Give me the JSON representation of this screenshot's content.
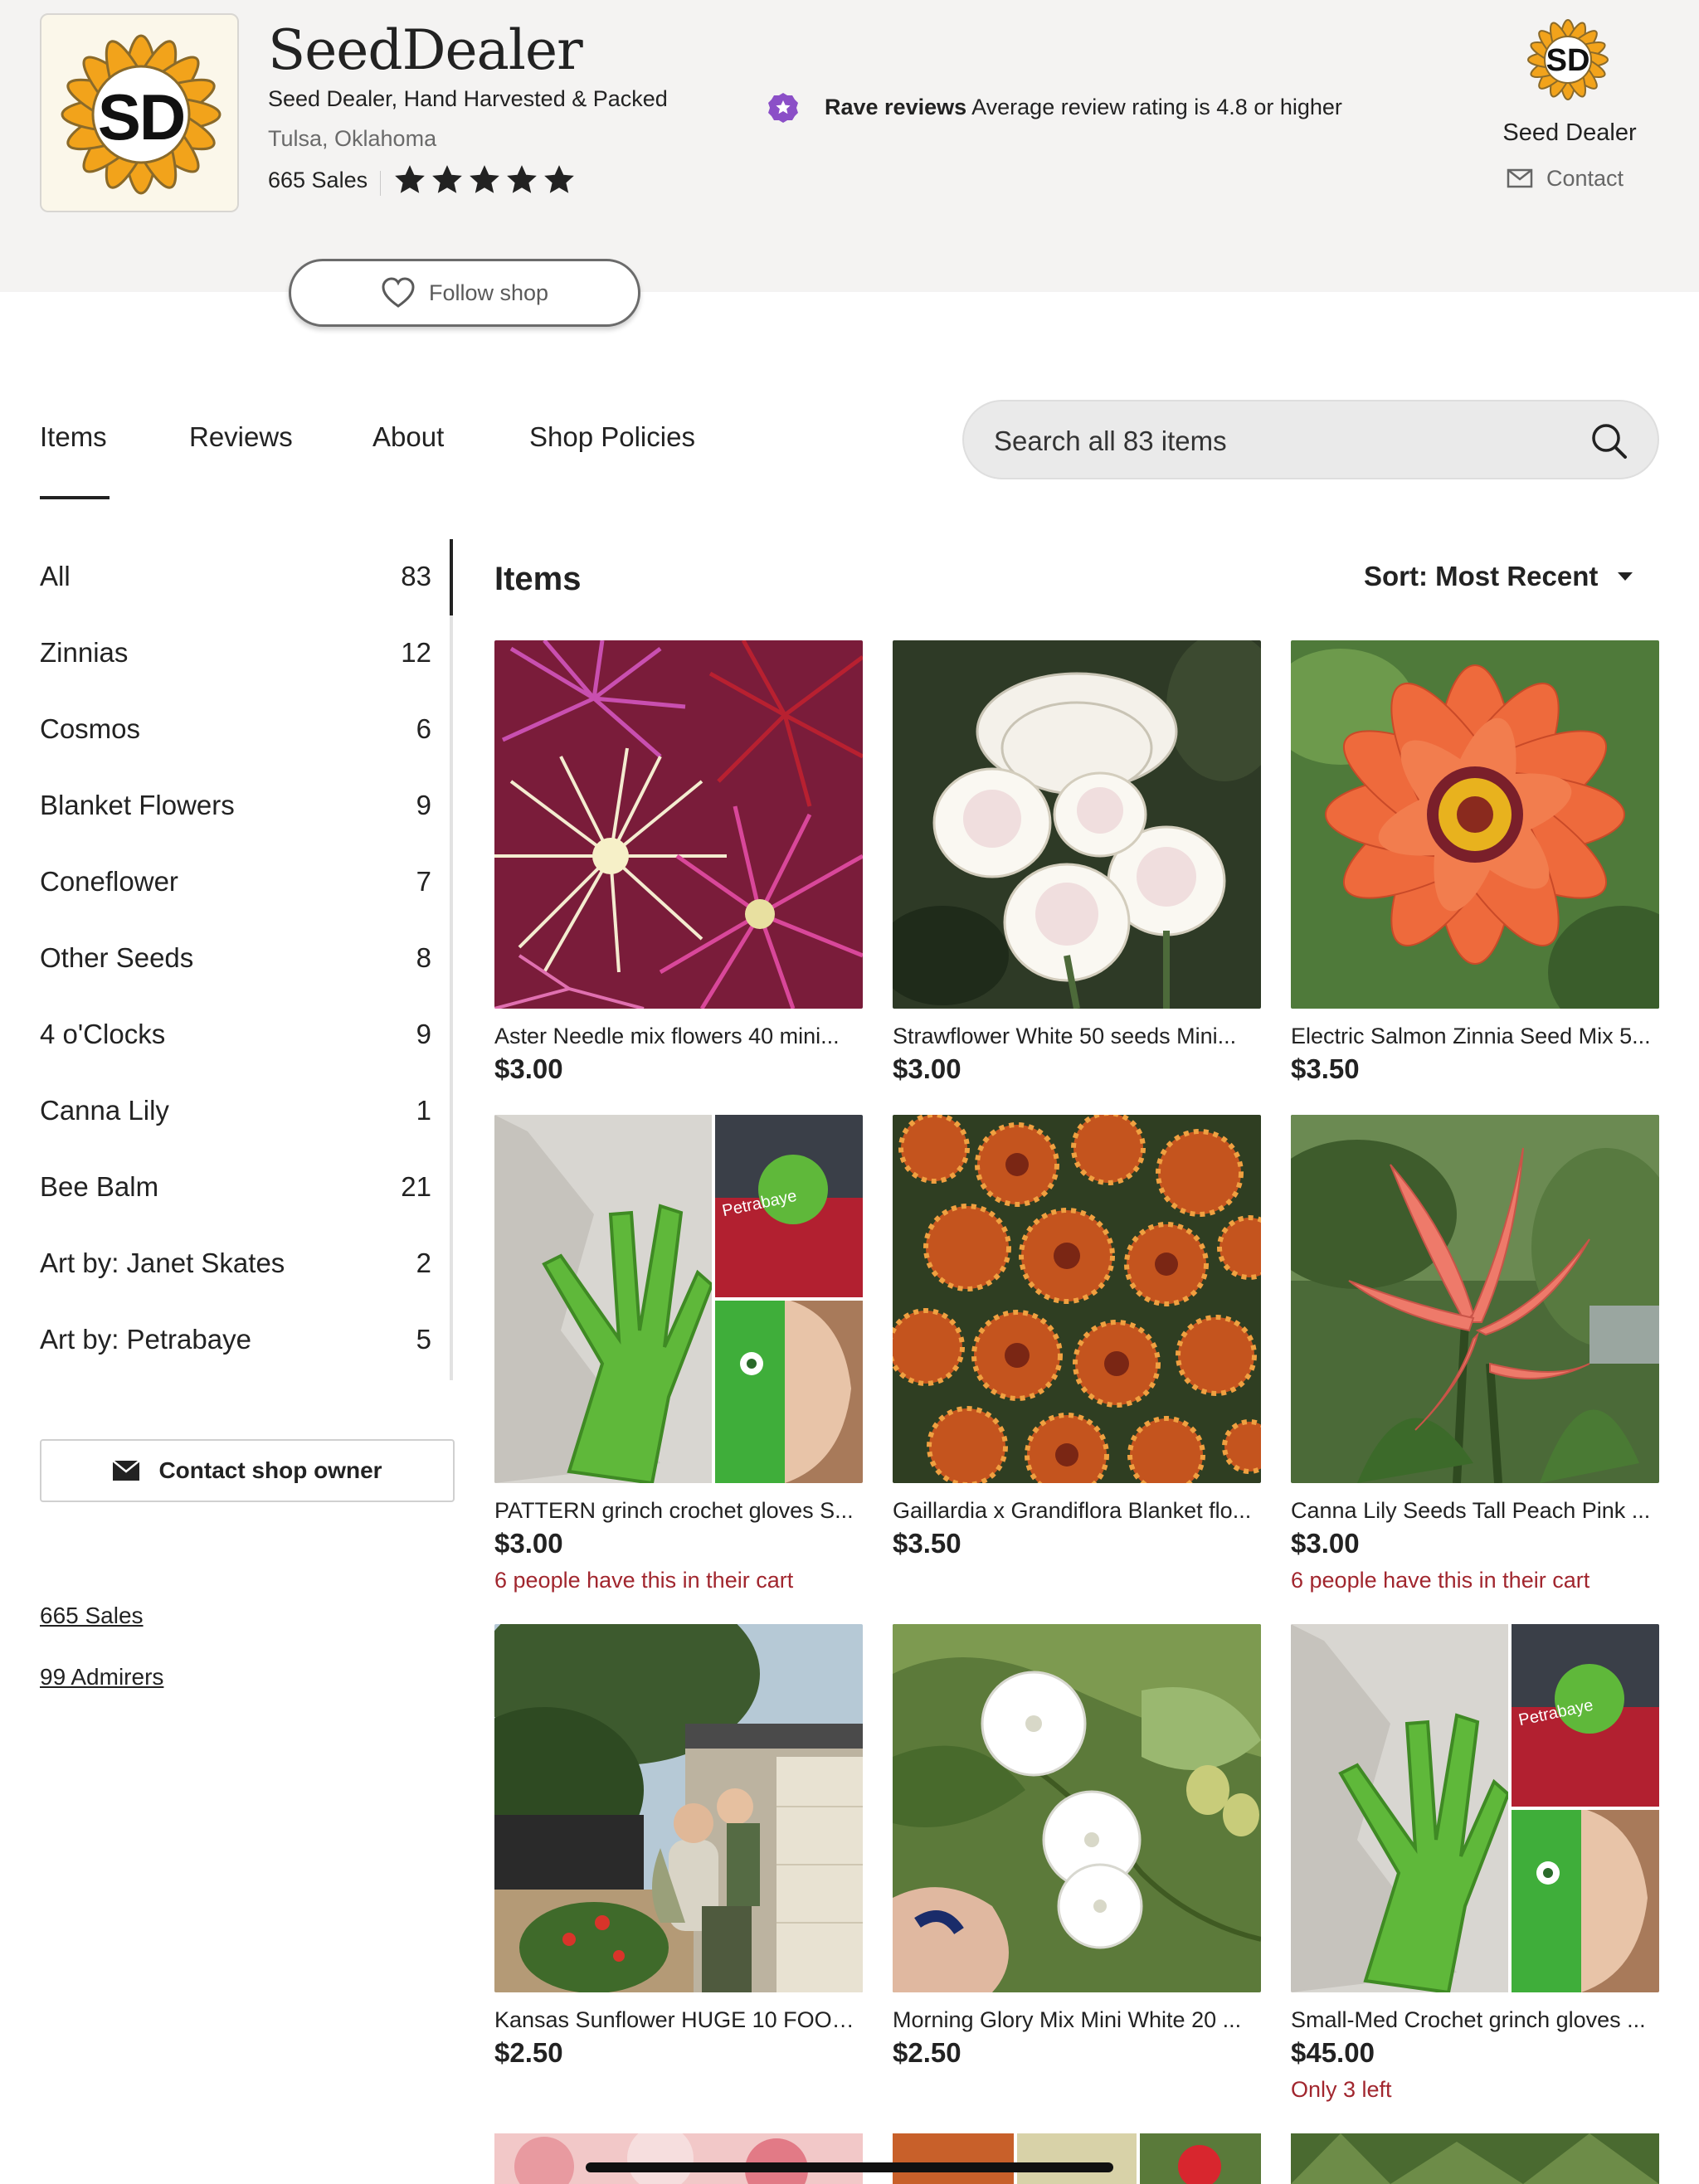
{
  "shop": {
    "name": "SeedDealer",
    "tagline": "Seed Dealer, Hand Harvested & Packed",
    "location": "Tulsa, Oklahoma",
    "sales": "665 Sales",
    "rating": 5,
    "logo_text": "SD",
    "accent_color": "#f2a31b"
  },
  "badge": {
    "title": "Rave reviews",
    "text": "Average review rating is 4.8 or higher",
    "color": "#8b4fc7"
  },
  "owner": {
    "name": "Seed Dealer",
    "contact_label": "Contact"
  },
  "follow": {
    "label": "Follow shop"
  },
  "tabs": [
    {
      "label": "Items"
    },
    {
      "label": "Reviews"
    },
    {
      "label": "About"
    },
    {
      "label": "Shop Policies"
    }
  ],
  "search": {
    "placeholder": "Search all 83 items"
  },
  "sidebar": {
    "categories": [
      {
        "label": "All",
        "count": "83"
      },
      {
        "label": "Zinnias",
        "count": "12"
      },
      {
        "label": "Cosmos",
        "count": "6"
      },
      {
        "label": "Blanket Flowers",
        "count": "9"
      },
      {
        "label": "Coneflower",
        "count": "7"
      },
      {
        "label": "Other Seeds",
        "count": "8"
      },
      {
        "label": "4 o'Clocks",
        "count": "9"
      },
      {
        "label": "Canna Lily",
        "count": "1"
      },
      {
        "label": "Bee Balm",
        "count": "21"
      },
      {
        "label": "Art by: Janet Skates",
        "count": "2"
      },
      {
        "label": "Art by: Petrabaye",
        "count": "5"
      }
    ],
    "contact_owner": "Contact shop owner",
    "sales_link": "665 Sales",
    "admirers_link": "99 Admirers"
  },
  "main": {
    "heading": "Items",
    "sort_label": "Sort: Most Recent",
    "items": [
      {
        "title": "Aster Needle mix flowers 40 mini...",
        "price": "$3.00",
        "note": ""
      },
      {
        "title": "Strawflower White 50 seeds Mini...",
        "price": "$3.00",
        "note": ""
      },
      {
        "title": "Electric Salmon Zinnia Seed Mix 5...",
        "price": "$3.50",
        "note": ""
      },
      {
        "title": "PATTERN grinch crochet gloves S...",
        "price": "$3.00",
        "note": "6 people have this in their cart",
        "image_label": "Petrabaye"
      },
      {
        "title": "Gaillardia x Grandiflora Blanket flo...",
        "price": "$3.50",
        "note": ""
      },
      {
        "title": "Canna Lily Seeds Tall Peach Pink ...",
        "price": "$3.00",
        "note": "6 people have this in their cart"
      },
      {
        "title": "Kansas Sunflower HUGE 10 FOOT ...",
        "price": "$2.50",
        "note": ""
      },
      {
        "title": "Morning Glory Mix Mini White 20 ...",
        "price": "$2.50",
        "note": ""
      },
      {
        "title": "Small-Med Crochet grinch gloves ...",
        "price": "$45.00",
        "note": "Only 3 left",
        "image_label": "Petrabaye"
      }
    ]
  }
}
